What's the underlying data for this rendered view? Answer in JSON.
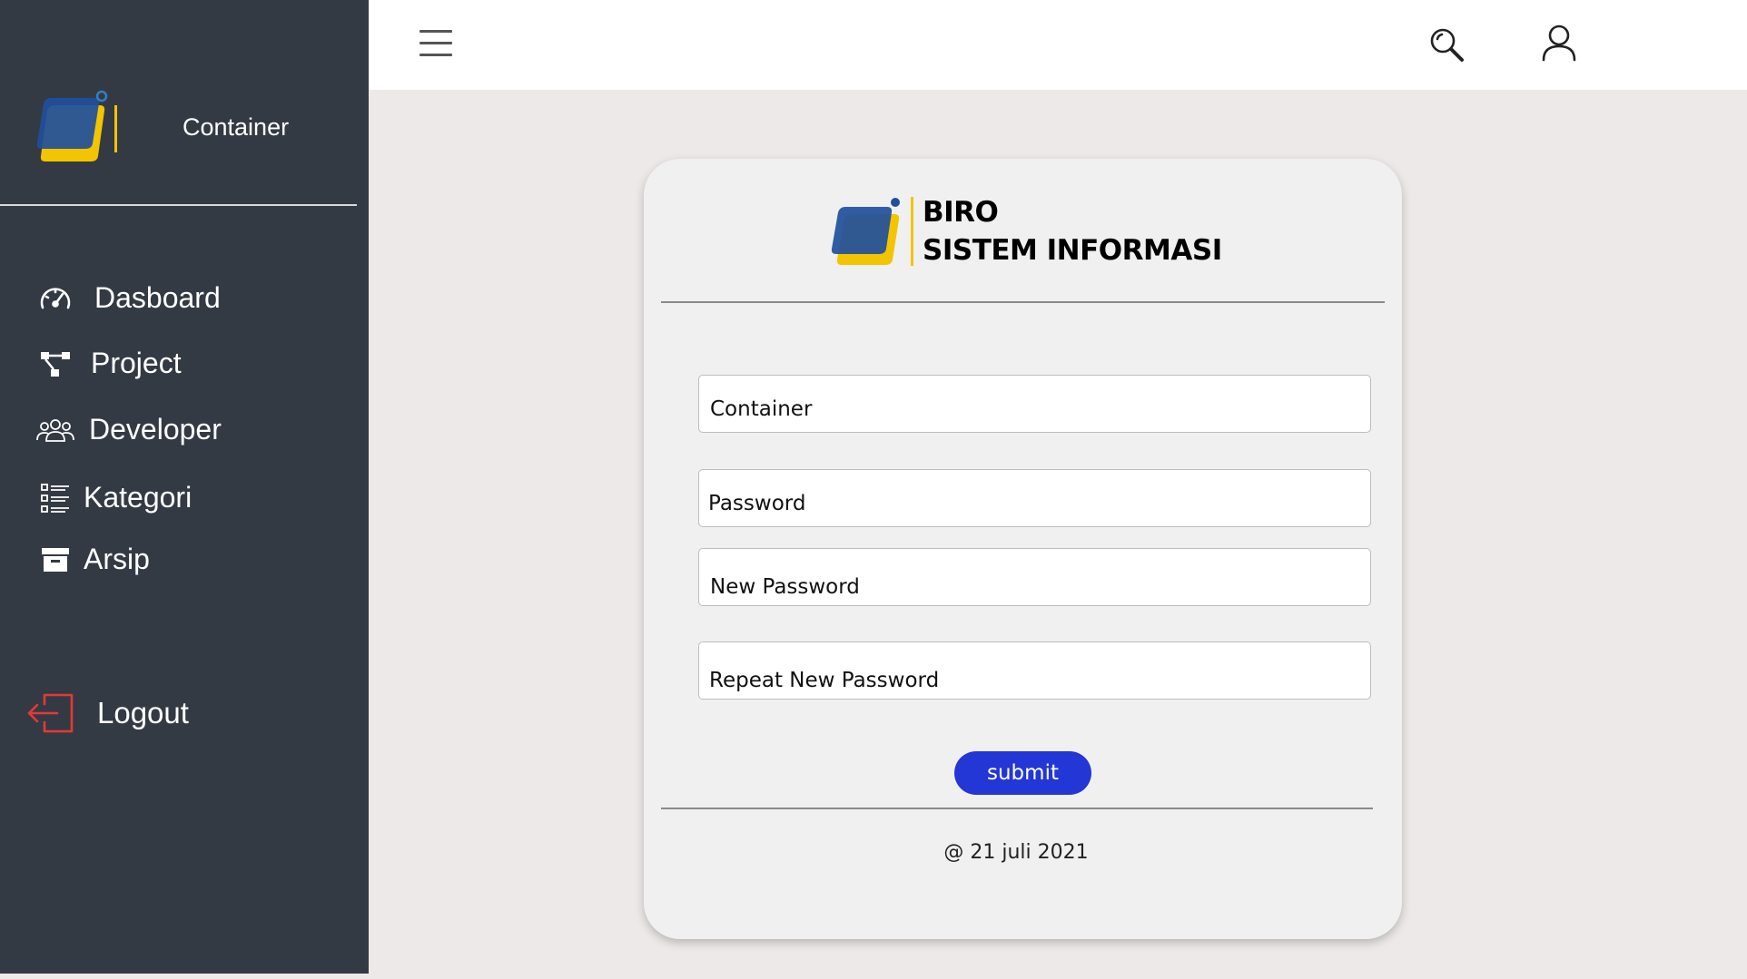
{
  "sidebar": {
    "brand_label": "Container",
    "items": [
      {
        "label": "Dasboard",
        "icon": "speedometer-icon"
      },
      {
        "label": "Project",
        "icon": "hierarchy-icon"
      },
      {
        "label": "Developer",
        "icon": "users-group-icon"
      },
      {
        "label": "Kategori",
        "icon": "list-icon"
      },
      {
        "label": "Arsip",
        "icon": "archive-box-icon"
      }
    ],
    "logout_label": "Logout",
    "logout_icon": "logout-icon"
  },
  "topbar": {
    "menu_icon": "hamburger-icon",
    "search_icon": "search-icon",
    "user_icon": "user-icon"
  },
  "card": {
    "title_line1": "BIRO",
    "title_line2": "SISTEM INFORMASI",
    "fields": {
      "username_placeholder": "Container",
      "password_placeholder": "Password",
      "new_password_placeholder": "New Password",
      "repeat_password_placeholder": "Repeat New Password"
    },
    "submit_label": "submit",
    "footer": "@ 21 juli 2021"
  },
  "colors": {
    "sidebar_bg": "#343a43",
    "content_bg": "#ece9e8",
    "submit_bg": "#2336d6",
    "logout_icon": "#e53935",
    "logo_yellow": "#f3c400",
    "logo_blue": "#1f4f9e"
  }
}
